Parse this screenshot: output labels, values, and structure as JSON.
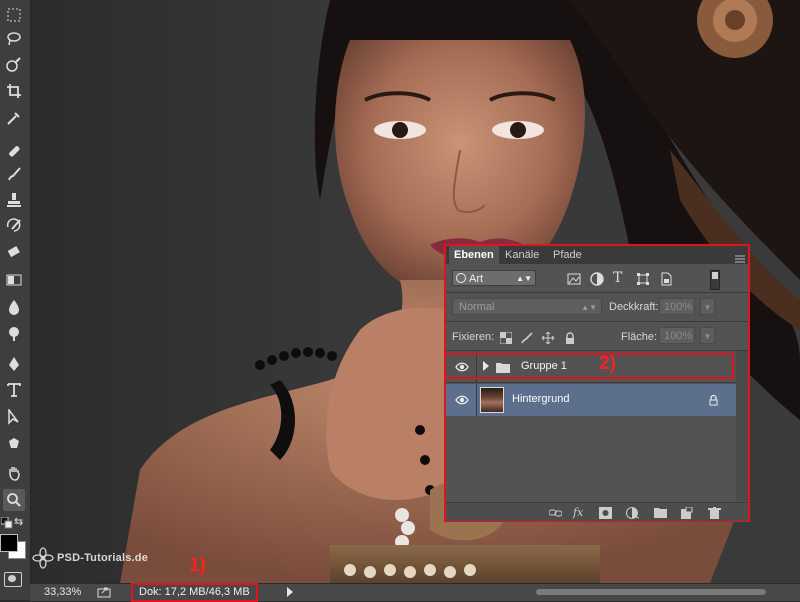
{
  "canvas": {
    "zoom": "33,33%",
    "doc_info": "Dok: 17,2 MB/46,3 MB"
  },
  "watermark": "PSD-Tutorials.de",
  "annotations": {
    "first": "1)",
    "second": "2)"
  },
  "layers_panel": {
    "tabs": [
      "Ebenen",
      "Kanäle",
      "Pfade"
    ],
    "active_tab": "Ebenen",
    "filter_kind": "Art",
    "blend_mode": "Normal",
    "opacity_label": "Deckkraft:",
    "opacity_value": "100%",
    "lock_label": "Fixieren:",
    "fill_label": "Fläche:",
    "fill_value": "100%",
    "layers": [
      {
        "name": "Gruppe 1",
        "type": "group",
        "visible": true
      },
      {
        "name": "Hintergrund",
        "type": "background",
        "visible": true,
        "locked": true,
        "selected": true
      }
    ],
    "footer_icons": [
      "link-icon",
      "fx-icon",
      "mask-icon",
      "adjustment-icon",
      "new-group-icon",
      "new-layer-icon",
      "trash-icon"
    ]
  },
  "toolbar": {
    "tools": [
      "marquee-icon",
      "lasso-icon",
      "quick-select-icon",
      "crop-icon",
      "eyedropper-icon",
      "healing-icon",
      "brush-icon",
      "stamp-icon",
      "history-brush-icon",
      "eraser-icon",
      "gradient-icon",
      "blur-icon",
      "dodge-icon",
      "pen-icon",
      "type-icon",
      "path-select-icon",
      "shape-icon",
      "hand-icon",
      "zoom-icon"
    ],
    "active_tool": "zoom-icon",
    "foreground_color": "#000000",
    "background_color": "#ffffff"
  },
  "colors": {
    "annotation_red": "#e0141e",
    "selected_layer": "#5c6f8c"
  }
}
